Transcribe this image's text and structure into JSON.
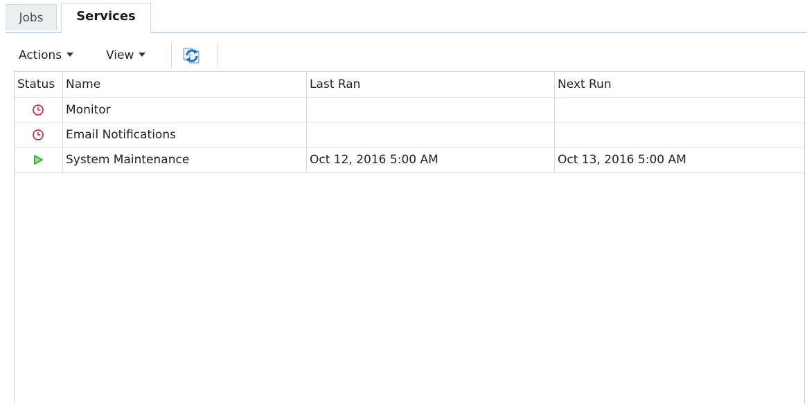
{
  "tabs": [
    {
      "label": "Jobs",
      "active": false
    },
    {
      "label": "Services",
      "active": true
    }
  ],
  "toolbar": {
    "actions_label": "Actions",
    "view_label": "View",
    "refresh_icon": "refresh-icon"
  },
  "table": {
    "columns": [
      "Status",
      "Name",
      "Last Ran",
      "Next Run"
    ],
    "rows": [
      {
        "status": "scheduled",
        "status_icon": "clock-icon",
        "name": "Monitor",
        "last_ran": "",
        "next_run": ""
      },
      {
        "status": "scheduled",
        "status_icon": "clock-icon",
        "name": "Email Notifications",
        "last_ran": "",
        "next_run": ""
      },
      {
        "status": "running",
        "status_icon": "play-icon",
        "name": "System Maintenance",
        "last_ran": "Oct 12, 2016 5:00 AM",
        "next_run": "Oct 13, 2016 5:00 AM"
      }
    ]
  },
  "colors": {
    "clock": "#c0394b",
    "play": "#2eaa2e",
    "tab_border": "#c9d7e6"
  }
}
